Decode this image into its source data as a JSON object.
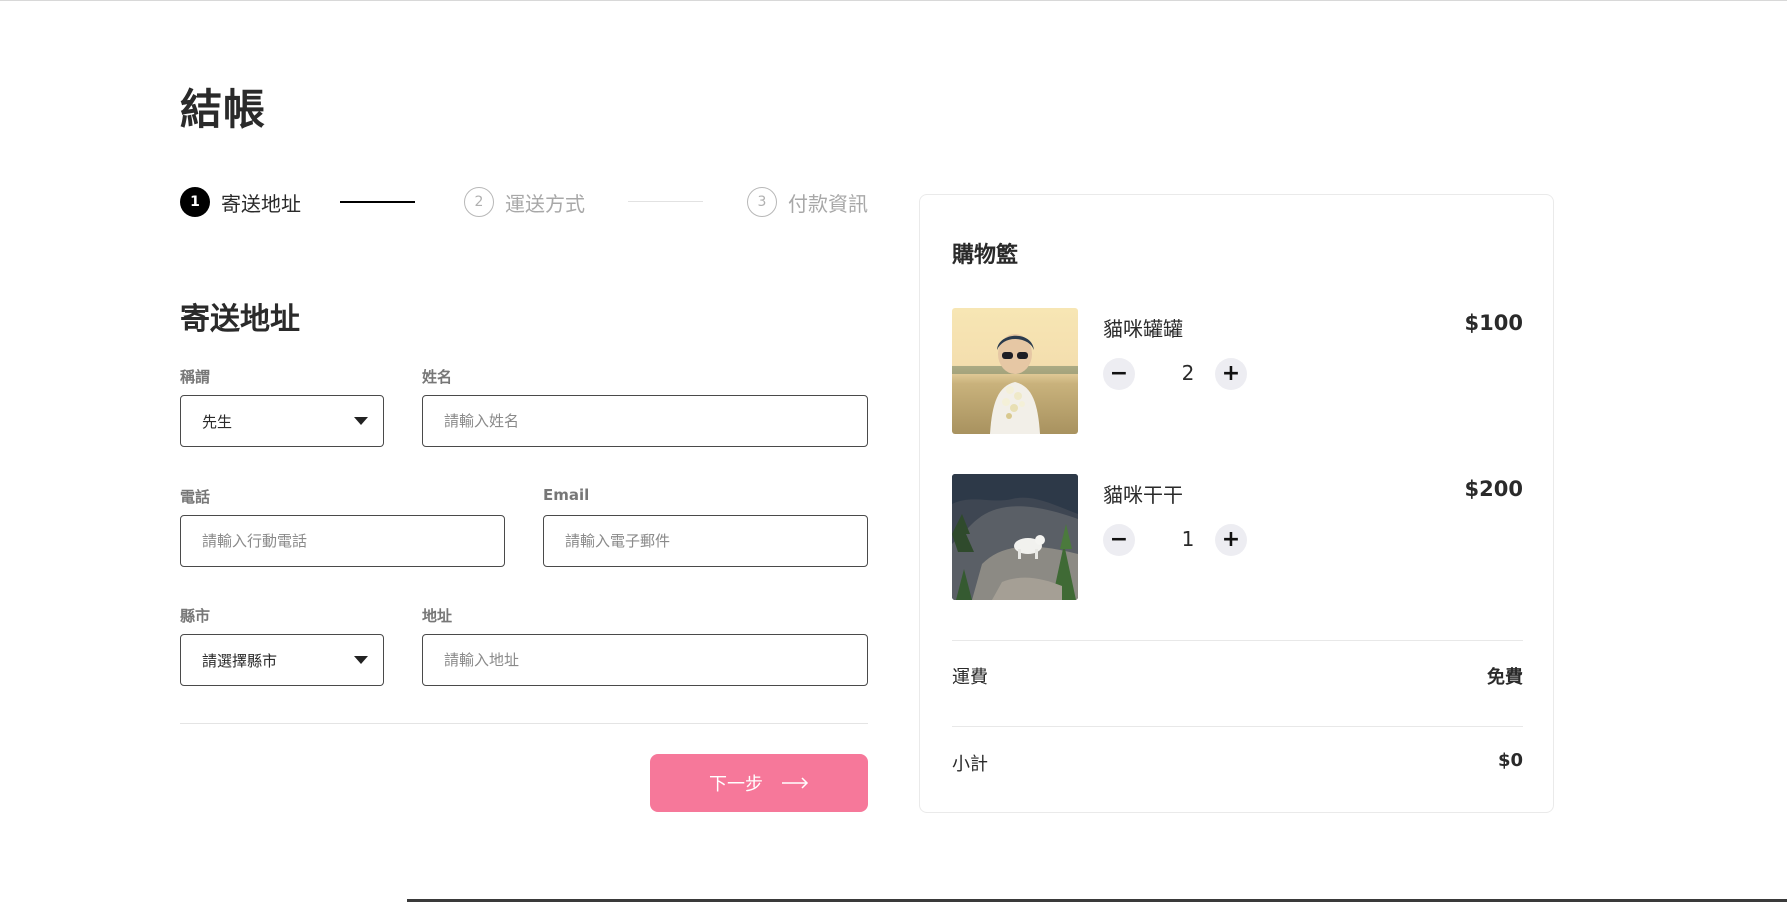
{
  "page": {
    "title": "結帳"
  },
  "stepper": {
    "steps": [
      {
        "number": "1",
        "label": "寄送地址",
        "active": true
      },
      {
        "number": "2",
        "label": "運送方式",
        "active": false
      },
      {
        "number": "3",
        "label": "付款資訊",
        "active": false
      }
    ]
  },
  "form": {
    "section_title": "寄送地址",
    "salutation": {
      "label": "稱謂",
      "value": "先生"
    },
    "name": {
      "label": "姓名",
      "placeholder": "請輸入姓名"
    },
    "phone": {
      "label": "電話",
      "placeholder": "請輸入行動電話"
    },
    "email": {
      "label": "Email",
      "placeholder": "請輸入電子郵件"
    },
    "city": {
      "label": "縣市",
      "value": "請選擇縣市"
    },
    "address": {
      "label": "地址",
      "placeholder": "請輸入地址"
    },
    "next_label": "下一步"
  },
  "cart": {
    "title": "購物籃",
    "items": [
      {
        "name": "貓咪罐罐",
        "price": "$100",
        "quantity": "2",
        "image": "woman-with-flowers-photo"
      },
      {
        "name": "貓咪干干",
        "price": "$200",
        "quantity": "1",
        "image": "mountain-goat-photo"
      }
    ],
    "shipping": {
      "label": "運費",
      "value": "免費"
    },
    "subtotal": {
      "label": "小計",
      "value": "$0"
    }
  },
  "colors": {
    "accent": "#f6789a",
    "text": "#2a2a2a",
    "muted": "#a8a8a8",
    "border": "#4a4a4a"
  }
}
